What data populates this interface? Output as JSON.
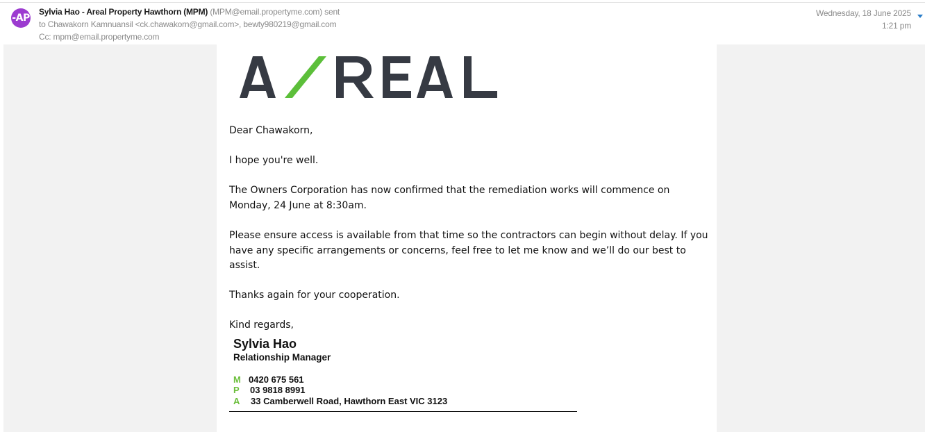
{
  "header": {
    "avatar_initials": "-AP",
    "sender_name": "Sylvia Hao - Areal Property Hawthorn (MPM)",
    "sender_email": "(MPM@email.propertyme.com)",
    "sent_word": "sent",
    "to_line": "to Chawakorn Kamnuansil <ck.chawakorn@gmail.com>, bewty980219@gmail.com",
    "cc_line": "Cc: mpm@email.propertyme.com",
    "date": "Wednesday, 18 June 2025",
    "time": "1:21 pm",
    "expand_icon": "chevron-down-icon"
  },
  "logo": {
    "text": "A/REAL",
    "letter_color": "#363a43",
    "slash_color": "#5cbf3a"
  },
  "message": {
    "greeting": "Dear Chawakorn,",
    "hope": "I hope you're well.",
    "confirm": "The Owners Corporation has now confirmed that the remediation works will commence on Monday, 24 June at 8:30am.",
    "access": "Please ensure access is available from that time so the contractors can begin without delay. If you have any specific arrangements or concerns, feel free to let me know and we’ll do our best to assist.",
    "thanks": "Thanks again for your cooperation.",
    "regards": "Kind regards,"
  },
  "signature": {
    "name": "Sylvia Hao",
    "title": "Relationship Manager",
    "mobile_key": "M",
    "mobile": "0420 675 561",
    "phone_key": "P",
    "phone": "03 9818 8991",
    "address_key": "A",
    "address": "33 Camberwell Road, Hawthorn East VIC 3123",
    "accent_color": "#6cbf3c"
  }
}
